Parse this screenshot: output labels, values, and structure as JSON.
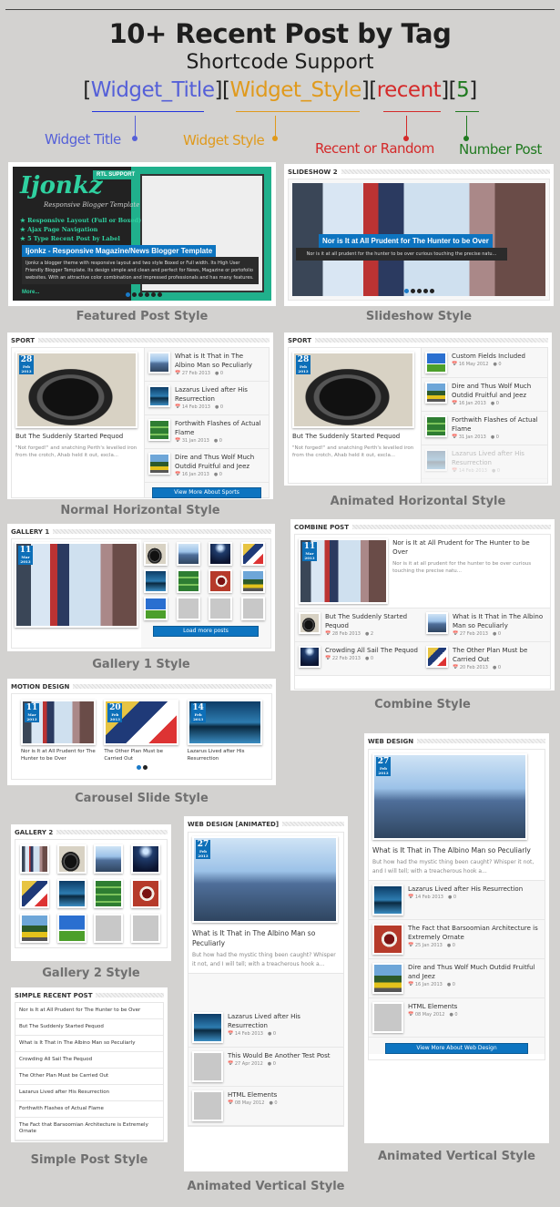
{
  "header": {
    "title": "10+ Recent Post by Tag",
    "subtitle": "Shortcode Support",
    "shortcode": {
      "open": "[",
      "close": "]",
      "title": "Widget_Title",
      "style": "Widget_Style",
      "mode": "recent",
      "count": "5"
    },
    "labels": {
      "title": "Widget Title",
      "style": "Widget Style",
      "mode": "Recent or Random",
      "count": "Number Post"
    },
    "colors": {
      "title": "#5560d8",
      "style": "#e09a1c",
      "mode": "#d42a2a",
      "count": "#207a20"
    }
  },
  "featured": {
    "caption": "Featured Post Style",
    "brand": "Ijonkz",
    "tagline": "Responsive Blogger Template",
    "rtl": "RTL SUPPORT",
    "features": [
      "Responsive Layout (Full or Boxed)",
      "Ajax Page Navigation",
      "5 Type Recent Post by Label"
    ],
    "post_title": "Ijonkz - Responsive Magazine/News Blogger Template",
    "post_excerpt": "Ijonkz a blogger theme with responsive layout and two style Boxed or Full width. Its High User Friendly Blogger Template. Its design simple and clean and perfect for News, Magazine or portofolio websites. With an attractive color combination and impressed professionals and has many features.",
    "more": "More..."
  },
  "slideshow": {
    "caption": "Slideshow Style",
    "widget_title": "SLIDESHOW 2",
    "post_title": "Nor is It at All Prudent for The Hunter to be Over",
    "excerpt": "Nor is it at all prudent for the hunter to be over curious touching the precise natu..."
  },
  "normal_horizontal": {
    "caption": "Normal Horizontal Style",
    "widget_title": "SPORT",
    "main": {
      "day": "28",
      "month": "Feb",
      "year": "2013",
      "title": "But The Suddenly Started Pequod",
      "excerpt": "\"Not forged!\" and snatching Perth's levelled iron from the crotch, Ahab held it out, excla..."
    },
    "items": [
      {
        "title": "What is It That in The Albino Man so Peculiarly",
        "date": "27 Feb 2013",
        "comments": "0",
        "img": "city"
      },
      {
        "title": "Lazarus Lived after His Resurrection",
        "date": "14 Feb 2013",
        "comments": "0",
        "img": "tower"
      },
      {
        "title": "Forthwith Flashes of Actual Flame",
        "date": "31 Jan 2013",
        "comments": "0",
        "img": "green"
      },
      {
        "title": "Dire and Thus Wolf Much Outdid Fruitful and Jeez",
        "date": "16 Jan 2013",
        "comments": "0",
        "img": "jeep"
      }
    ],
    "button": "View More About Sports"
  },
  "animated_horizontal": {
    "caption": "Animated Horizontal Style",
    "widget_title": "SPORT",
    "main": {
      "day": "28",
      "month": "Feb",
      "year": "2013",
      "title": "But The Suddenly Started Pequod",
      "excerpt": "\"Not forged!\" and snatching Perth's levelled iron from the crotch, Ahab held it out, excla..."
    },
    "items": [
      {
        "title": "Custom Fields Included",
        "date": "16 May 2012",
        "comments": "0",
        "img": "field"
      },
      {
        "title": "Dire and Thus Wolf Much Outdid Fruitful and Jeez",
        "date": "16 Jan 2013",
        "comments": "0",
        "img": "jeep"
      },
      {
        "title": "Forthwith Flashes of Actual Flame",
        "date": "31 Jan 2013",
        "comments": "0",
        "img": "green"
      },
      {
        "title": "Lazarus Lived after His Resurrection",
        "date": "14 Feb 2013",
        "comments": "0",
        "img": "tower"
      }
    ]
  },
  "gallery1": {
    "caption": "Gallery 1  Style",
    "widget_title": "GALLERY 1",
    "main": {
      "day": "11",
      "month": "Mar",
      "year": "2013"
    },
    "thumbs": [
      "headphones",
      "city",
      "concert",
      "hockey",
      "tower",
      "green",
      "tea",
      "jeep",
      "field",
      "blank",
      "blank",
      "blank"
    ],
    "button": "Load more posts"
  },
  "combine": {
    "caption": "Combine Style",
    "widget_title": "COMBINE POST",
    "main": {
      "day": "11",
      "month": "Mar",
      "year": "2013",
      "title": "Nor is It at All Prudent for The Hunter to be Over",
      "excerpt": "Nor is it at all prudent for the hunter to be over curious touching the precise natu..."
    },
    "items": [
      {
        "title": "But The Suddenly Started Pequod",
        "date": "28 Feb 2013",
        "comments": "2",
        "img": "headphones"
      },
      {
        "title": "What is It That in The Albino Man so Peculiarly",
        "date": "27 Feb 2013",
        "comments": "0",
        "img": "city"
      },
      {
        "title": "Crowding All Sail The Pequod",
        "date": "22 Feb 2013",
        "comments": "0",
        "img": "concert"
      },
      {
        "title": "The Other Plan Must be Carried Out",
        "date": "20 Feb 2013",
        "comments": "0",
        "img": "hockey"
      }
    ]
  },
  "carousel": {
    "caption": "Carousel Slide  Style",
    "widget_title": "MOTION DESIGN",
    "items": [
      {
        "day": "11",
        "month": "Mar",
        "year": "2013",
        "title": "Nor is It at All Prudent for The Hunter to be Over",
        "img": "times"
      },
      {
        "day": "20",
        "month": "Feb",
        "year": "2013",
        "title": "The Other Plan Must be Carried Out",
        "img": "hockey"
      },
      {
        "day": "14",
        "month": "Feb",
        "year": "2013",
        "title": "Lazarus Lived after His Resurrection",
        "img": "tower"
      }
    ]
  },
  "gallery2": {
    "caption": "Gallery 2  Style",
    "widget_title": "GALLERY 2",
    "thumbs": [
      "times",
      "headphones",
      "city",
      "concert",
      "hockey",
      "tower",
      "green",
      "tea",
      "jeep",
      "field",
      "blank",
      "blank"
    ]
  },
  "simple": {
    "caption": "Simple Post  Style",
    "widget_title": "SIMPLE RECENT POST",
    "items": [
      "Nor is It at All Prudent for The Hunter to be Over",
      "But The Suddenly Started Pequod",
      "What is It That in The Albino Man so Peculiarly",
      "Crowding All Sail The Pequod",
      "The Other Plan Must be Carried Out",
      "Lazarus Lived after His Resurrection",
      "Forthwith Flashes of Actual Flame",
      "The Fact that Barsoomian Architecture is Extremely Ornate"
    ]
  },
  "vertical_animated": {
    "caption": "Animated Vertical  Style",
    "widget_title": "WEB DESIGN [ANIMATED]",
    "main": {
      "day": "27",
      "month": "Feb",
      "year": "2013",
      "title": "What is It That in The Albino Man so Peculiarly",
      "excerpt": "But how had the mystic thing been caught? Whisper it not, and I will tell; with a treacherous hook a..."
    },
    "items": [
      {
        "title": "Lazarus Lived after His Resurrection",
        "date": "14 Feb 2013",
        "comments": "0",
        "img": "tower"
      },
      {
        "title": "This Would Be Another Test Post",
        "date": "27 Apr 2012",
        "comments": "0",
        "img": "blank"
      },
      {
        "title": "HTML Elements",
        "date": "08 May 2012",
        "comments": "0",
        "img": "blank"
      }
    ]
  },
  "vertical": {
    "caption": "Animated Vertical  Style",
    "widget_title": "WEB DESIGN",
    "main": {
      "day": "27",
      "month": "Feb",
      "year": "2013",
      "title": "What is It That in The Albino Man so Peculiarly",
      "excerpt": "But how had the mystic thing been caught? Whisper it not, and I will tell; with a treacherous hook a..."
    },
    "items": [
      {
        "title": "Lazarus Lived after His Resurrection",
        "date": "14 Feb 2013",
        "comments": "0",
        "img": "tower"
      },
      {
        "title": "The Fact that Barsoomian Architecture is Extremely Ornate",
        "date": "25 Jan 2013",
        "comments": "0",
        "img": "tea"
      },
      {
        "title": "Dire and Thus Wolf Much Outdid Fruitful and Jeez",
        "date": "16 Jan 2013",
        "comments": "0",
        "img": "jeep"
      },
      {
        "title": "HTML Elements",
        "date": "08 May 2012",
        "comments": "0",
        "img": "blank"
      }
    ],
    "button": "View More About Web Design"
  }
}
